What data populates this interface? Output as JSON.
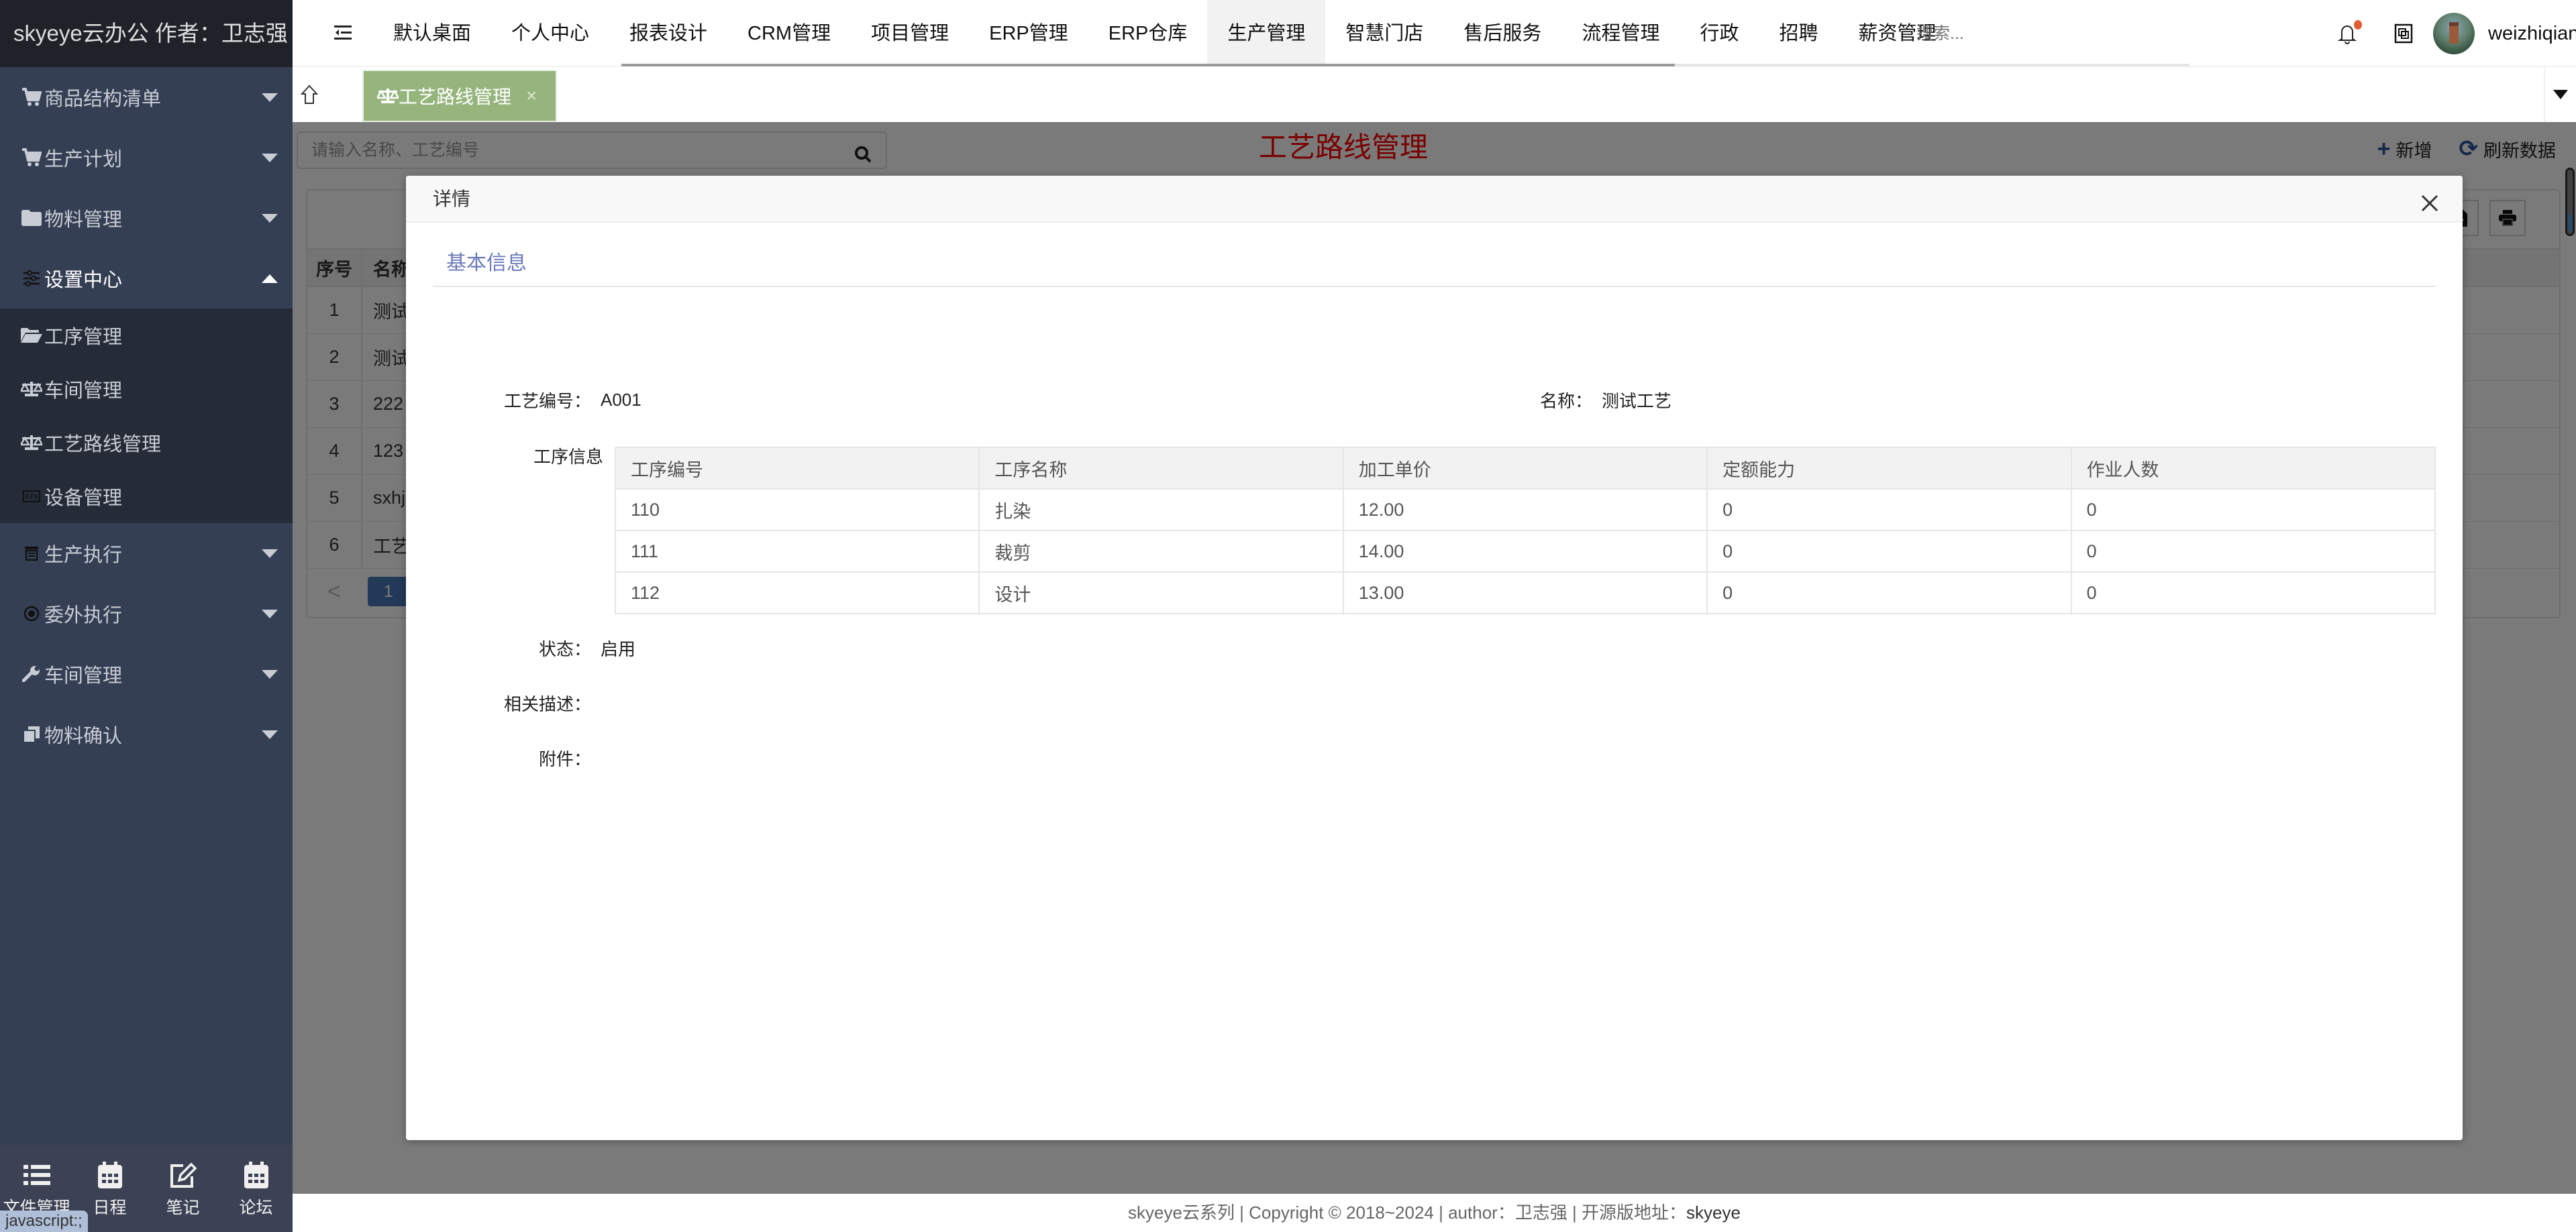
{
  "app": {
    "brand": "skyeye云办公 作者：卫志强",
    "status_hint": "javascript:;"
  },
  "sidebar": {
    "items": [
      {
        "label": "商品结构清单",
        "icon": "cart-download-icon",
        "expanded": false
      },
      {
        "label": "生产计划",
        "icon": "cart-download-icon",
        "expanded": false
      },
      {
        "label": "物料管理",
        "icon": "folder-icon",
        "expanded": false
      },
      {
        "label": "设置中心",
        "icon": "sliders-icon",
        "expanded": true,
        "children": [
          {
            "label": "工序管理",
            "icon": "folder-open-icon"
          },
          {
            "label": "车间管理",
            "icon": "balance-scale-icon"
          },
          {
            "label": "工艺路线管理",
            "icon": "balance-scale-icon"
          },
          {
            "label": "设备管理",
            "icon": "code-window-icon"
          }
        ]
      },
      {
        "label": "生产执行",
        "icon": "archive-icon",
        "expanded": false
      },
      {
        "label": "委外执行",
        "icon": "radio-dot-icon",
        "expanded": false
      },
      {
        "label": "车间管理",
        "icon": "wrench-icon",
        "expanded": false
      },
      {
        "label": "物料确认",
        "icon": "copy-icon",
        "expanded": false
      }
    ],
    "bottom_tools": [
      {
        "label": "文件管理",
        "icon": "list-icon"
      },
      {
        "label": "日程",
        "icon": "calendar-icon"
      },
      {
        "label": "笔记",
        "icon": "edit-icon"
      },
      {
        "label": "论坛",
        "icon": "calendar-icon"
      }
    ]
  },
  "topnav": {
    "items": [
      "默认桌面",
      "个人中心",
      "报表设计",
      "CRM管理",
      "项目管理",
      "ERP管理",
      "ERP仓库",
      "生产管理",
      "智慧门店",
      "售后服务",
      "流程管理",
      "行政",
      "招聘",
      "薪资管理"
    ],
    "active_index": 7,
    "search_placeholder": "搜索...",
    "notification_badge": true,
    "username": "weizhiqiang(:"
  },
  "tabs": [
    {
      "label": "工艺路线管理",
      "icon": "balance-scale-icon",
      "close": "×",
      "active": true
    }
  ],
  "page": {
    "title": "工艺路线管理",
    "search_placeholder": "请输入名称、工艺编号",
    "actions": [
      {
        "label": "新增",
        "icon": "plus-icon"
      },
      {
        "label": "刷新数据",
        "icon": "refresh-icon"
      }
    ],
    "grid": {
      "headers": [
        "序号",
        "名称"
      ],
      "rows": [
        [
          "1",
          "测试"
        ],
        [
          "2",
          "测试"
        ],
        [
          "3",
          "222"
        ],
        [
          "4",
          "123"
        ],
        [
          "5",
          "sxhjs"
        ],
        [
          "6",
          "工艺"
        ]
      ],
      "current_page": "1",
      "prev": "<"
    }
  },
  "modal": {
    "title": "详情",
    "section": "基本信息",
    "fields": {
      "code_label": "工艺编号：",
      "code_value": "A001",
      "name_label": "名称：",
      "name_value": "测试工艺",
      "process_label": "工序信息",
      "status_label": "状态：",
      "status_value": "启用",
      "desc_label": "相关描述：",
      "desc_value": "",
      "attach_label": "附件：",
      "attach_value": ""
    },
    "process_table": {
      "headers": [
        "工序编号",
        "工序名称",
        "加工单价",
        "定额能力",
        "作业人数"
      ],
      "rows": [
        [
          "110",
          "扎染",
          "12.00",
          "0",
          "0"
        ],
        [
          "111",
          "裁剪",
          "14.00",
          "0",
          "0"
        ],
        [
          "112",
          "设计",
          "13.00",
          "0",
          "0"
        ]
      ]
    }
  },
  "footer": {
    "text": "skyeye云系列 | Copyright © 2018~2024 | author：卫志强 | 开源版地址：",
    "link": "skyeye"
  },
  "colors": {
    "sidebar_bg": "#353f54",
    "brand_bg": "#20222a",
    "tab_active": "#95b57d",
    "page_title": "#ff0000",
    "section_title": "#6a7ab8",
    "accent_blue": "#2a5298",
    "notification_dot": "#e25d33"
  }
}
